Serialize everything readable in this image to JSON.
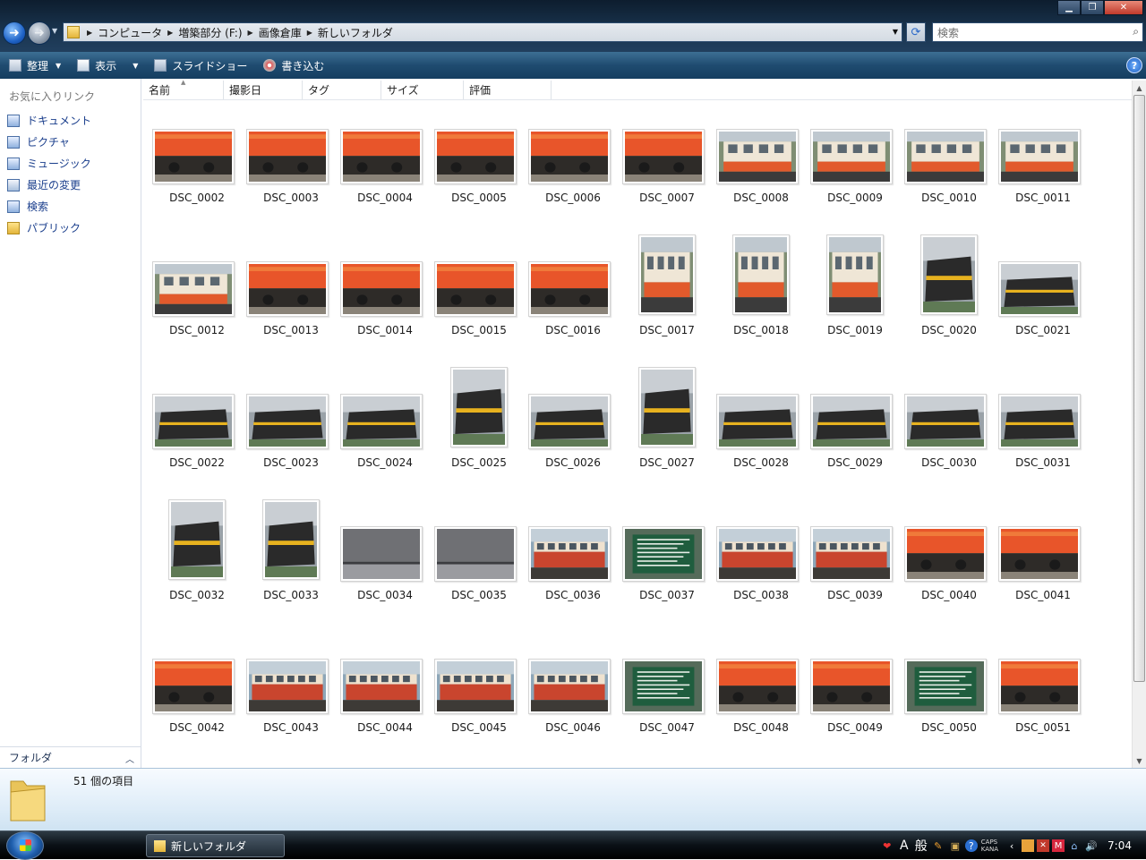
{
  "window": {
    "address": [
      "コンピュータ",
      "増築部分 (F:)",
      "画像倉庫",
      "新しいフォルダ"
    ],
    "search_placeholder": "検索"
  },
  "toolbar": {
    "organize": "整理",
    "view": "表示",
    "slideshow": "スライドショー",
    "burn": "書き込む"
  },
  "sidebar": {
    "favorites_title": "お気に入りリンク",
    "links": [
      "ドキュメント",
      "ピクチャ",
      "ミュージック",
      "最近の変更",
      "検索",
      "パブリック"
    ],
    "folders_label": "フォルダ"
  },
  "columns": [
    "名前",
    "撮影日",
    "タグ",
    "サイズ",
    "評価"
  ],
  "files": [
    {
      "name": "DSC_0002",
      "o": "l",
      "t": "orange"
    },
    {
      "name": "DSC_0003",
      "o": "l",
      "t": "orange"
    },
    {
      "name": "DSC_0004",
      "o": "l",
      "t": "orange"
    },
    {
      "name": "DSC_0005",
      "o": "l",
      "t": "orange"
    },
    {
      "name": "DSC_0006",
      "o": "l",
      "t": "orange"
    },
    {
      "name": "DSC_0007",
      "o": "l",
      "t": "orange"
    },
    {
      "name": "DSC_0008",
      "o": "l",
      "t": "cream"
    },
    {
      "name": "DSC_0009",
      "o": "l",
      "t": "cream"
    },
    {
      "name": "DSC_0010",
      "o": "l",
      "t": "cream"
    },
    {
      "name": "DSC_0011",
      "o": "l",
      "t": "cream"
    },
    {
      "name": "DSC_0012",
      "o": "l",
      "t": "cream"
    },
    {
      "name": "DSC_0013",
      "o": "l",
      "t": "orange"
    },
    {
      "name": "DSC_0014",
      "o": "l",
      "t": "orange"
    },
    {
      "name": "DSC_0015",
      "o": "l",
      "t": "orange"
    },
    {
      "name": "DSC_0016",
      "o": "l",
      "t": "orange"
    },
    {
      "name": "DSC_0017",
      "o": "p",
      "t": "cream"
    },
    {
      "name": "DSC_0018",
      "o": "p",
      "t": "cream"
    },
    {
      "name": "DSC_0019",
      "o": "p",
      "t": "cream"
    },
    {
      "name": "DSC_0020",
      "o": "p",
      "t": "black"
    },
    {
      "name": "DSC_0021",
      "o": "l",
      "t": "black"
    },
    {
      "name": "DSC_0022",
      "o": "l",
      "t": "black"
    },
    {
      "name": "DSC_0023",
      "o": "l",
      "t": "black"
    },
    {
      "name": "DSC_0024",
      "o": "l",
      "t": "black"
    },
    {
      "name": "DSC_0025",
      "o": "p",
      "t": "black"
    },
    {
      "name": "DSC_0026",
      "o": "l",
      "t": "black"
    },
    {
      "name": "DSC_0027",
      "o": "p",
      "t": "black"
    },
    {
      "name": "DSC_0028",
      "o": "l",
      "t": "black"
    },
    {
      "name": "DSC_0029",
      "o": "l",
      "t": "black"
    },
    {
      "name": "DSC_0030",
      "o": "l",
      "t": "black"
    },
    {
      "name": "DSC_0031",
      "o": "l",
      "t": "black"
    },
    {
      "name": "DSC_0032",
      "o": "p",
      "t": "black"
    },
    {
      "name": "DSC_0033",
      "o": "p",
      "t": "black"
    },
    {
      "name": "DSC_0034",
      "o": "l",
      "t": "gray"
    },
    {
      "name": "DSC_0035",
      "o": "l",
      "t": "gray"
    },
    {
      "name": "DSC_0036",
      "o": "l",
      "t": "red"
    },
    {
      "name": "DSC_0037",
      "o": "l",
      "t": "sign"
    },
    {
      "name": "DSC_0038",
      "o": "l",
      "t": "red"
    },
    {
      "name": "DSC_0039",
      "o": "l",
      "t": "red"
    },
    {
      "name": "DSC_0040",
      "o": "l",
      "t": "orange"
    },
    {
      "name": "DSC_0041",
      "o": "l",
      "t": "orange"
    },
    {
      "name": "DSC_0042",
      "o": "l",
      "t": "orange"
    },
    {
      "name": "DSC_0043",
      "o": "l",
      "t": "red"
    },
    {
      "name": "DSC_0044",
      "o": "l",
      "t": "red"
    },
    {
      "name": "DSC_0045",
      "o": "l",
      "t": "red"
    },
    {
      "name": "DSC_0046",
      "o": "l",
      "t": "red"
    },
    {
      "name": "DSC_0047",
      "o": "l",
      "t": "sign"
    },
    {
      "name": "DSC_0048",
      "o": "l",
      "t": "orange"
    },
    {
      "name": "DSC_0049",
      "o": "l",
      "t": "orange"
    },
    {
      "name": "DSC_0050",
      "o": "l",
      "t": "sign"
    },
    {
      "name": "DSC_0051",
      "o": "l",
      "t": "orange"
    }
  ],
  "details": {
    "count_text": "51 個の項目"
  },
  "taskbar": {
    "task_label": "新しいフォルダ",
    "ime_mode": "般",
    "ime_letter": "A",
    "caps": "CAPS",
    "kana": "KANA",
    "clock": "7:04"
  }
}
